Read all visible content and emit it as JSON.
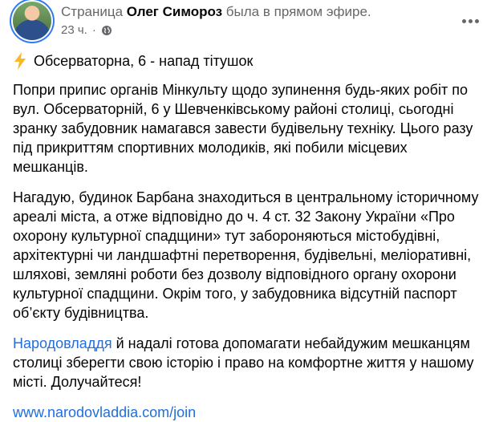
{
  "post": {
    "header": {
      "prefix": "Страница ",
      "author": "Олег Симороз",
      "suffix": " была в прямом эфире.",
      "time": "23 ч.",
      "separator": "·",
      "visibility_icon": "globe-icon",
      "avatar_ring_color": "#2d7bf3"
    },
    "body": {
      "headline_icon": "lightning-icon",
      "headline": "Обсерваторна, 6 - напад тітушок",
      "paragraph1": "Попри припис органів Мінкульту щодо зупинення будь-яких робіт по вул. Обсерваторній, 6 у Шевченківському районі столиці, сьогодні зранку забудовник намагався завести будівельну техніку. Цього разу під прикриттям спортивних молодиків, які побили місцевих мешканців.",
      "paragraph2": "Нагадую, будинок Барбана знаходиться в центральному історичному ареалі міста, а отже відповідно до ч. 4 ст. 32 Закону України «Про охорону культурної спадщини» тут забороняються містобудівні, архітектурні чи ландшафтні перетворення, будівельні, меліоративні, шляхові, земляні роботи без дозволу відповідного органу охорони культурної спадщини. Окрім того, у забудовника відсутній паспорт об’єкту будівництва.",
      "paragraph3_link": "Народовладдя",
      "paragraph3_text": " й надалі готова допомагати небайдужим мешканцям столиці зберегти свою історію і право на комфортне життя у нашому місті. Долучайтеся!",
      "url_link": "www.narodovladdia.com/join",
      "link_color": "#216fdb"
    }
  }
}
